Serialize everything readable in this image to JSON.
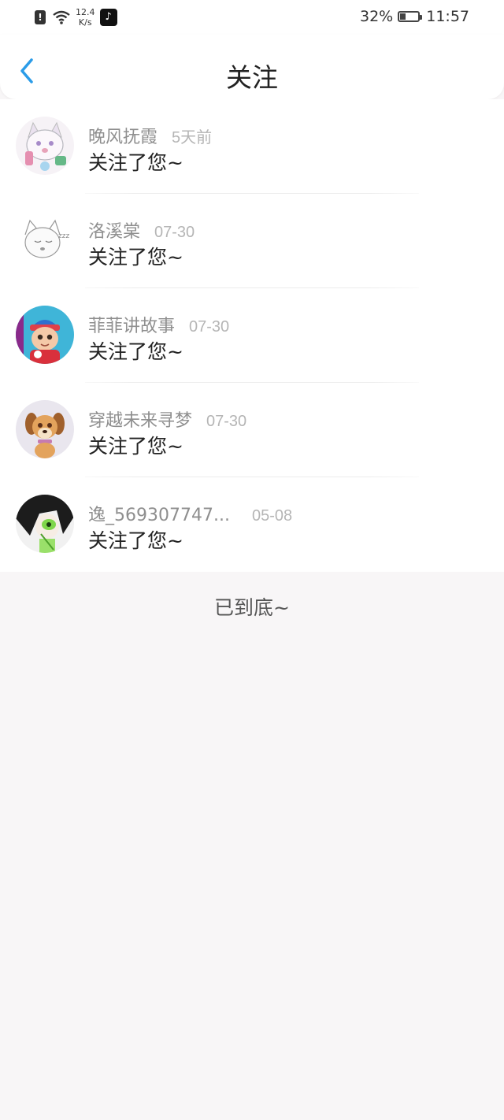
{
  "status_bar": {
    "speed_value": "12.4",
    "speed_unit": "K/s",
    "battery_percent": "32%",
    "time": "11:57"
  },
  "header": {
    "title": "关注"
  },
  "items": [
    {
      "name": "晚风抚霞",
      "time": "5天前",
      "message": "关注了您~"
    },
    {
      "name": "洛溪棠",
      "time": "07-30",
      "message": "关注了您~"
    },
    {
      "name": "菲菲讲故事",
      "time": "07-30",
      "message": "关注了您~"
    },
    {
      "name": "穿越未来寻梦",
      "time": "07-30",
      "message": "关注了您~"
    },
    {
      "name": "逸_569307747...",
      "time": "05-08",
      "message": "关注了您~"
    }
  ],
  "footer": {
    "end_text": "已到底~"
  },
  "colors": {
    "accent": "#2b9ce8",
    "name_gray": "#8f8f8f",
    "time_gray": "#b5b5b5",
    "background": "#f8f6f7"
  }
}
